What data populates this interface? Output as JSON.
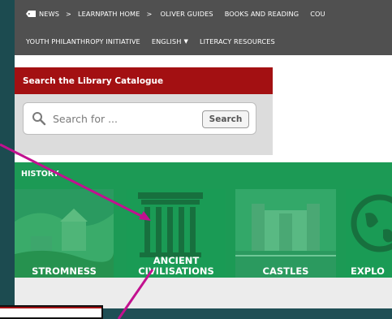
{
  "nav": {
    "row1": [
      {
        "label": "NEWS",
        "icon": "tag-icon"
      },
      {
        "label": "LEARNPATH HOME",
        "separator": ">"
      },
      {
        "label": "OLIVER GUIDES"
      },
      {
        "label": "BOOKS AND READING"
      },
      {
        "label": "COU"
      }
    ],
    "separator": ">",
    "row2": [
      {
        "label": "YOUTH PHILANTHROPY INITIATIVE"
      },
      {
        "label": "ENGLISH",
        "caret": "▼"
      },
      {
        "label": "LITERACY RESOURCES"
      }
    ]
  },
  "search": {
    "title": "Search the Library Catalogue",
    "placeholder": "Search for ...",
    "button_label": "Search"
  },
  "history": {
    "title": "HISTORY",
    "tiles": [
      {
        "label": "STROMNESS"
      },
      {
        "label": "ANCIENT CIVILISATIONS",
        "line1": "ANCIENT",
        "line2": "CIVILISATIONS"
      },
      {
        "label": "CASTLES"
      },
      {
        "label": "EXPLO"
      }
    ]
  },
  "colors": {
    "nav_bg": "#505050",
    "search_header": "#a31012",
    "history_green": "#1c9a55",
    "arrow_magenta": "#c2118f",
    "frame_teal": "#1f4f55"
  }
}
